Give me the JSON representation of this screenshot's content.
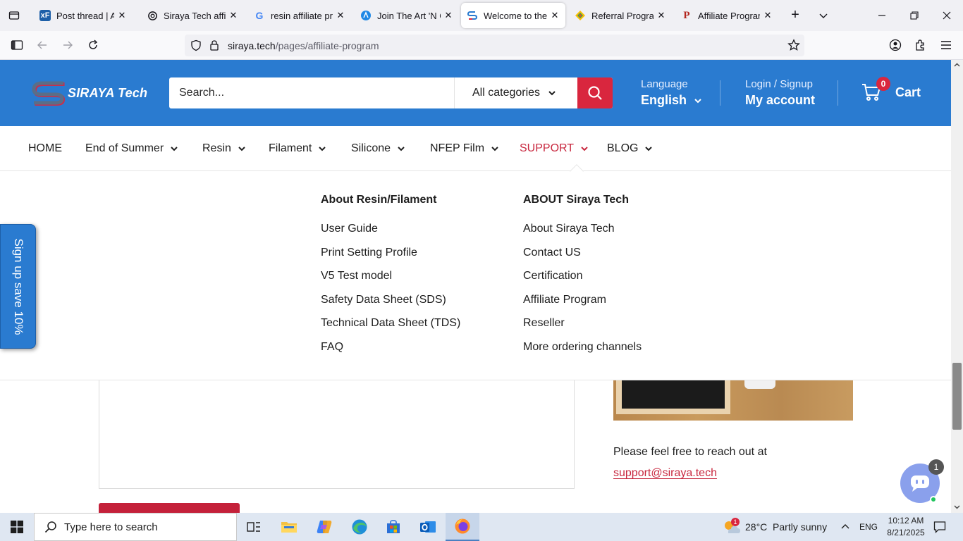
{
  "browser": {
    "tabs": [
      {
        "title": "Post thread | Affili",
        "favicon": "xf-icon",
        "active": false
      },
      {
        "title": "Siraya Tech affiliat",
        "favicon": "openai-icon",
        "active": false
      },
      {
        "title": "resin affiliate prog",
        "favicon": "google-icon",
        "active": false
      },
      {
        "title": "Join The Art 'N Gl",
        "favicon": "brand-icon",
        "active": false
      },
      {
        "title": "Welcome to the S",
        "favicon": "siraya-icon",
        "active": true
      },
      {
        "title": "Referral Program",
        "favicon": "referral-icon",
        "active": false
      },
      {
        "title": "Affiliate Program",
        "favicon": "p-icon",
        "active": false
      }
    ],
    "url_domain": "siraya.tech",
    "url_path": "/pages/affiliate-program"
  },
  "header": {
    "logo_text": "SIRAYA Tech",
    "search_placeholder": "Search...",
    "category_label": "All categories",
    "language_label": "Language",
    "language_value": "English",
    "login_label": "Login / Signup",
    "account_label": "My account",
    "cart_count": "0",
    "cart_label": "Cart"
  },
  "menu": {
    "items": [
      {
        "label": "HOME",
        "has_dropdown": false
      },
      {
        "label": "End of Summer",
        "has_dropdown": true
      },
      {
        "label": "Resin",
        "has_dropdown": true
      },
      {
        "label": "Filament",
        "has_dropdown": true
      },
      {
        "label": "Silicone",
        "has_dropdown": true
      },
      {
        "label": "NFEP Film",
        "has_dropdown": true
      },
      {
        "label": "SUPPORT",
        "has_dropdown": true,
        "active": true
      },
      {
        "label": "BLOG",
        "has_dropdown": true
      }
    ]
  },
  "mega": {
    "col1": {
      "heading": "About Resin/Filament",
      "links": [
        "User Guide",
        "Print Setting Profile",
        "V5 Test model",
        "Safety Data Sheet (SDS)",
        "Technical Data Sheet (TDS)",
        "FAQ"
      ]
    },
    "col2": {
      "heading": "ABOUT Siraya Tech",
      "links": [
        "About Siraya Tech",
        "Contact US",
        "Certification",
        "Affiliate Program",
        "Reseller",
        "More ordering channels"
      ]
    }
  },
  "page": {
    "signup_tab": "Sign up save 10%",
    "reach_text": "Please feel free to reach out at",
    "email": "support@siraya.tech",
    "chat_badge": "1"
  },
  "taskbar": {
    "search_placeholder": "Type here to search",
    "weather_badge": "1",
    "weather": "28°C  Partly sunny",
    "lang": "ENG",
    "time": "10:12 AM",
    "date": "8/21/2025"
  },
  "colors": {
    "brand_blue": "#2a7bd0",
    "accent_red": "#d9263e",
    "link_red": "#c8283f"
  }
}
